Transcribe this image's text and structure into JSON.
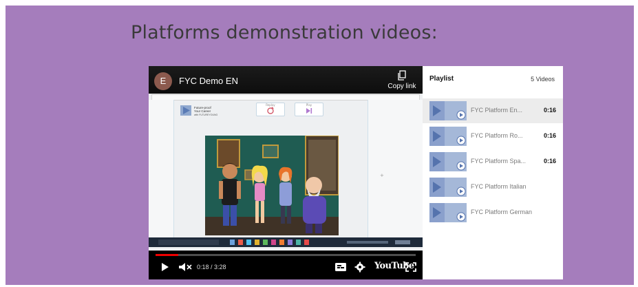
{
  "slide": {
    "title": "Platforms demonstration videos:",
    "background": "#a57dbc"
  },
  "player": {
    "channel_initial": "E",
    "title": "FYC Demo EN",
    "copy_link_label": "Copy link",
    "time": "0:18 / 3:28",
    "progress_fraction": 0.087,
    "logo_text": "YouTube",
    "icons": [
      "copy-icon",
      "play-icon",
      "mute-icon",
      "captions-icon",
      "settings-icon",
      "fullscreen-icon"
    ]
  },
  "playlist": {
    "title": "Playlist",
    "count": "5 Videos",
    "items": [
      {
        "title": "FYC Platform En...",
        "duration": "0:16",
        "active": true
      },
      {
        "title": "FYC Platform Ro...",
        "duration": "0:16",
        "active": false
      },
      {
        "title": "FYC Platform Spa...",
        "duration": "0:16",
        "active": false
      },
      {
        "title": "FYC Platform Italian",
        "duration": "",
        "active": false
      },
      {
        "title": "FYC Platform German",
        "duration": "",
        "active": false
      }
    ]
  },
  "video_frame": {
    "site_buttons": [
      "Replay",
      "Play"
    ],
    "logo_lines": [
      "Future-proof",
      "Your Career",
      "with FUTUREYOUNG"
    ]
  }
}
